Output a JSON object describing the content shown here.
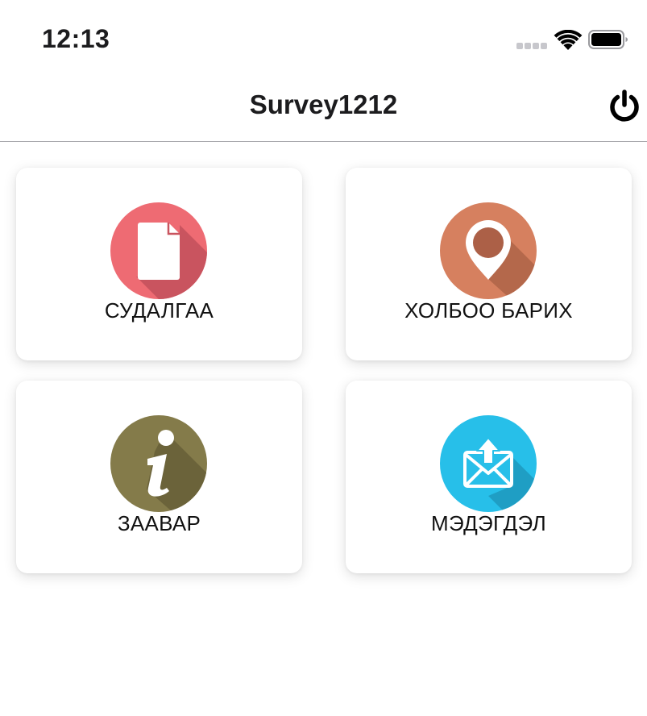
{
  "status_bar": {
    "time": "12:13",
    "icons": [
      "signal-icon",
      "wifi-icon",
      "battery-icon"
    ]
  },
  "nav": {
    "title": "Survey1212",
    "power_icon": "power-icon"
  },
  "menu": {
    "items": [
      {
        "label": "СУДАЛГАА",
        "icon": "document-icon",
        "color": "#ee6b73"
      },
      {
        "label": "ХОЛБОО БАРИХ",
        "icon": "location-pin-icon",
        "color": "#d6805f"
      },
      {
        "label": "ЗААВАР",
        "icon": "info-icon",
        "color": "#847b4a"
      },
      {
        "label": "МЭДЭГДЭЛ",
        "icon": "mail-upload-icon",
        "color": "#27bfe9"
      }
    ]
  }
}
